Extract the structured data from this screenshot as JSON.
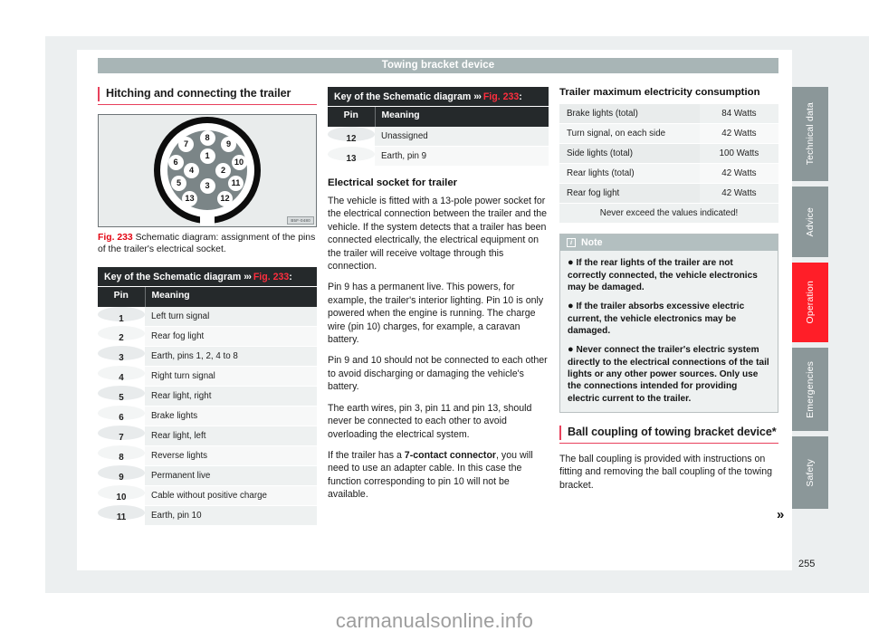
{
  "header": {
    "title": "Towing bracket device"
  },
  "column1": {
    "section_heading": "Hitching and connecting the trailer",
    "figure": {
      "image_code": "B5F-0480",
      "caption_number": "Fig. 233",
      "caption_text": "Schematic diagram: assignment of the pins of the trailer's electrical socket.",
      "pins": [
        "1",
        "2",
        "3",
        "4",
        "5",
        "6",
        "7",
        "8",
        "9",
        "10",
        "11",
        "12",
        "13"
      ]
    },
    "key_table": {
      "caption_prefix": "Key of the Schematic diagram",
      "caption_arrows": "›››",
      "caption_ref": "Fig. 233",
      "caption_suffix": ":",
      "columns": [
        "Pin",
        "Meaning"
      ],
      "rows": [
        {
          "pin": "1",
          "meaning": "Left turn signal"
        },
        {
          "pin": "2",
          "meaning": "Rear fog light"
        },
        {
          "pin": "3",
          "meaning": "Earth, pins 1, 2, 4 to 8"
        },
        {
          "pin": "4",
          "meaning": "Right turn signal"
        },
        {
          "pin": "5",
          "meaning": "Rear light, right"
        },
        {
          "pin": "6",
          "meaning": "Brake lights"
        },
        {
          "pin": "7",
          "meaning": "Rear light, left"
        },
        {
          "pin": "8",
          "meaning": "Reverse lights"
        },
        {
          "pin": "9",
          "meaning": "Permanent live"
        },
        {
          "pin": "10",
          "meaning": "Cable without positive charge"
        },
        {
          "pin": "11",
          "meaning": "Earth, pin 10"
        }
      ]
    }
  },
  "column2": {
    "key_table": {
      "caption_prefix": "Key of the Schematic diagram",
      "caption_arrows": "›››",
      "caption_ref": "Fig. 233",
      "caption_suffix": ":",
      "columns": [
        "Pin",
        "Meaning"
      ],
      "rows": [
        {
          "pin": "12",
          "meaning": "Unassigned"
        },
        {
          "pin": "13",
          "meaning": "Earth, pin 9"
        }
      ]
    },
    "sub_heading": "Electrical socket for trailer",
    "paragraphs": [
      "The vehicle is fitted with a 13-pole power socket for the electrical connection between the trailer and the vehicle. If the system detects that a trailer has been connected electrically, the electrical equipment on the trailer will receive voltage through this connection.",
      "Pin 9 has a permanent live. This powers, for example, the trailer's interior lighting. Pin 10 is only powered when the engine is running. The charge wire (pin 10) charges, for example, a caravan battery.",
      "Pin 9 and 10 should not be connected to each other to avoid discharging or damaging the vehicle's battery.",
      "The earth wires, pin 3, pin 11 and pin 13, should never be connected to each other to avoid overloading the electrical system."
    ],
    "last_paragraph": {
      "before": "If the trailer has a ",
      "bold": "7-contact connector",
      "after": ", you will need to use an adapter cable. In this case the function corresponding to pin 10 will not be available."
    }
  },
  "column3": {
    "consumption_heading": "Trailer maximum electricity consumption",
    "consumption_rows": [
      {
        "label": "Brake lights (total)",
        "value": "84 Watts"
      },
      {
        "label": "Turn signal, on each side",
        "value": "42 Watts"
      },
      {
        "label": "Side lights (total)",
        "value": "100 Watts"
      },
      {
        "label": "Rear lights (total)",
        "value": "42 Watts"
      },
      {
        "label": "Rear fog light",
        "value": "42 Watts"
      }
    ],
    "consumption_footer": "Never exceed the values indicated!",
    "note": {
      "icon": "info-icon",
      "title": "Note",
      "bullets": [
        "If the rear lights of the trailer are not correctly connected, the vehicle electronics may be damaged.",
        "If the trailer absorbs excessive electric current, the vehicle electronics may be damaged.",
        "Never connect the trailer's electric system directly to the electrical connections of the tail lights or any other power sources. Only use the connections intended for providing electric current to the trailer."
      ]
    },
    "ball_heading": "Ball coupling of towing bracket device*",
    "ball_paragraph": "The ball coupling is provided with instructions on fitting and removing the ball coupling of the towing bracket."
  },
  "side_tabs": [
    {
      "label": "Technical data",
      "active": false
    },
    {
      "label": "Advice",
      "active": false
    },
    {
      "label": "Operation",
      "active": true
    },
    {
      "label": "Emergencies",
      "active": false
    },
    {
      "label": "Safety",
      "active": false
    }
  ],
  "continuation_marker": "»",
  "page_number": "255",
  "watermark": "carmanualsonline.info",
  "colors": {
    "accent_red": "#e8415c",
    "ref_red": "#e30613",
    "tab_active": "#ff1e28",
    "tab_inactive": "#8b9799",
    "title_bar": "#a8b5b6",
    "table_header": "#25292b"
  }
}
